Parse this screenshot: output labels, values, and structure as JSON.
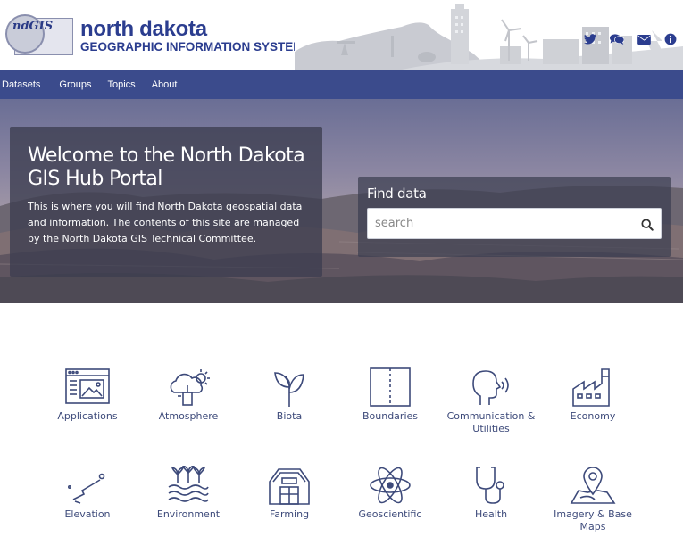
{
  "header": {
    "brand_line1": "north dakota",
    "brand_line2": "GEOGRAPHIC INFORMATION SYSTEMS",
    "logo_text": "ndGIS",
    "social_icons": [
      "twitter-icon",
      "comments-icon",
      "envelope-icon",
      "info-icon"
    ]
  },
  "nav": {
    "items": [
      "Datasets",
      "Groups",
      "Topics",
      "About"
    ]
  },
  "hero": {
    "welcome_title": "Welcome to the North Dakota GIS Hub Portal",
    "welcome_text": "This is where you will find North Dakota geospatial data and information. The contents of this site are managed by the North Dakota GIS Technical Committee.",
    "find_title": "Find data",
    "search_placeholder": "search"
  },
  "categories": [
    {
      "label": "Applications",
      "icon": "applications-icon"
    },
    {
      "label": "Atmosphere",
      "icon": "atmosphere-icon"
    },
    {
      "label": "Biota",
      "icon": "biota-icon"
    },
    {
      "label": "Boundaries",
      "icon": "boundaries-icon"
    },
    {
      "label": "Communication & Utilities",
      "icon": "communication-icon"
    },
    {
      "label": "Economy",
      "icon": "economy-icon"
    },
    {
      "label": "Elevation",
      "icon": "elevation-icon"
    },
    {
      "label": "Environment",
      "icon": "environment-icon"
    },
    {
      "label": "Farming",
      "icon": "farming-icon"
    },
    {
      "label": "Geoscientific",
      "icon": "geoscientific-icon"
    },
    {
      "label": "Health",
      "icon": "health-icon"
    },
    {
      "label": "Imagery & Base Maps",
      "icon": "imagery-icon"
    }
  ],
  "colors": {
    "brand_blue": "#2b3d8f",
    "nav_bg": "#3b4b8c",
    "icon_color": "#3d4a7a"
  }
}
